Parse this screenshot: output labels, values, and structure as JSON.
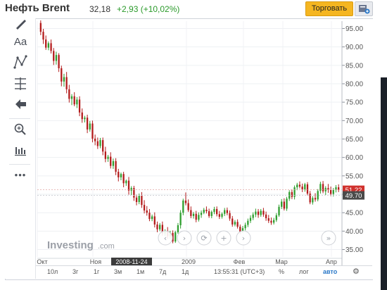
{
  "header": {
    "title": "Нефть Brent",
    "price": "32,18",
    "change": "+2,93 (+10,02%)",
    "trade_button": "Торговать"
  },
  "toolbar": {
    "icons": [
      "pencil-icon",
      "text-icon",
      "pattern-icon",
      "fibonacci-icon",
      "back-arrow-icon",
      "zoom-icon",
      "indicators-icon",
      "more-icon"
    ],
    "text_tool_label": "Aa",
    "more_label": "•••"
  },
  "chart_data": {
    "type": "candlestick",
    "title": "",
    "xlabel": "",
    "ylabel": "",
    "ylim": [
      33,
      97
    ],
    "yticks": [
      35,
      40,
      45,
      50,
      55,
      60,
      65,
      70,
      75,
      80,
      85,
      90,
      95
    ],
    "ytick_labels": [
      "35.00",
      "40.00",
      "45.00",
      "50.00",
      "55.00",
      "60.00",
      "65.00",
      "70.00",
      "75.00",
      "80.00",
      "85.00",
      "90.00",
      "95.00"
    ],
    "x_labels": [
      "Окт",
      "Ноя",
      "Дек",
      "2009",
      "Фев",
      "Мар",
      "Апр"
    ],
    "crosshair_date": "2008-11-24",
    "price_badges": [
      {
        "value": "51.22",
        "color": "#d0312d"
      },
      {
        "value": "49.70",
        "color": "#4a4a4a"
      }
    ],
    "watermark_main": "Investing",
    "watermark_suffix": ".com",
    "up_color": "#2e9e2e",
    "down_color": "#b31b1b",
    "closes": [
      96.5,
      94.8,
      91.5,
      89.0,
      86.5,
      84.5,
      82.0,
      80.5,
      79.5,
      78.5,
      77.0,
      75.5,
      74.5,
      74.0,
      72.8,
      72.0,
      71.5,
      70.5,
      69.5,
      68.5,
      67.5,
      66.5,
      65.5,
      64.5,
      63.5,
      62.5,
      61.5,
      60.5,
      59.8,
      59.0,
      58.3,
      57.6,
      57.0,
      56.2,
      55.5,
      54.8,
      54.0,
      53.2,
      52.5,
      51.8,
      51.0,
      50.3,
      49.7,
      49.0,
      48.3,
      47.7,
      47.0,
      46.3,
      45.6,
      45.0,
      44.4,
      43.8,
      43.2,
      42.6,
      42.0,
      41.5,
      41.0,
      40.5,
      40.2,
      40.0,
      40.2,
      40.5,
      40.8,
      41.2,
      41.6,
      42.0,
      42.4,
      42.8,
      43.2,
      43.6,
      44.0,
      44.3,
      44.6,
      44.8,
      45.0,
      45.2,
      45.3,
      45.4,
      45.5,
      45.5,
      45.4,
      45.3,
      45.1,
      44.9,
      44.7,
      44.5,
      44.3,
      44.1,
      43.9,
      43.7,
      43.5,
      43.3,
      43.1,
      42.9,
      42.7,
      42.5,
      42.5,
      42.7,
      43.0,
      43.4,
      43.8,
      44.2,
      44.6,
      45.0,
      45.5,
      46.0,
      46.6,
      47.2,
      47.8,
      48.4,
      49.0,
      49.6,
      50.2,
      50.7,
      51.2,
      51.6,
      52.0,
      52.3,
      52.5,
      52.4,
      52.2,
      51.9,
      51.6,
      51.3,
      51.1,
      50.9,
      50.7,
      50.6,
      50.5,
      50.5,
      50.6,
      50.8,
      51.0,
      51.2
    ],
    "candles": [
      [
        96.5,
        97.2,
        93.2,
        94.1
      ],
      [
        94.1,
        94.9,
        90.8,
        92.0
      ],
      [
        92.0,
        93.1,
        89.2,
        89.8
      ],
      [
        89.8,
        91.5,
        89.1,
        91.0
      ],
      [
        91.0,
        92.0,
        88.2,
        88.9
      ],
      [
        88.9,
        89.7,
        85.1,
        86.2
      ],
      [
        86.2,
        88.7,
        85.2,
        87.8
      ],
      [
        87.8,
        88.3,
        83.2,
        84.2
      ],
      [
        84.2,
        84.9,
        79.3,
        80.6
      ],
      [
        80.6,
        82.7,
        79.2,
        81.8
      ],
      [
        81.8,
        83.2,
        77.4,
        78.5
      ],
      [
        78.5,
        79.7,
        74.9,
        75.9
      ],
      [
        75.9,
        77.2,
        74.2,
        76.6
      ],
      [
        76.6,
        77.7,
        73.9,
        74.4
      ],
      [
        74.4,
        76.4,
        73.4,
        75.7
      ],
      [
        75.7,
        76.6,
        71.2,
        72.2
      ],
      [
        72.2,
        73.3,
        69.4,
        70.4
      ],
      [
        70.4,
        71.3,
        69.5,
        70.8
      ],
      [
        70.8,
        71.6,
        66.6,
        67.6
      ],
      [
        67.6,
        69.9,
        67.0,
        69.2
      ],
      [
        69.2,
        70.0,
        64.1,
        65.1
      ],
      [
        65.1,
        66.2,
        63.3,
        64.4
      ],
      [
        64.4,
        65.4,
        62.3,
        63.1
      ],
      [
        63.1,
        65.3,
        62.5,
        64.7
      ],
      [
        64.7,
        65.4,
        60.6,
        61.6
      ],
      [
        61.6,
        62.9,
        58.7,
        59.6
      ],
      [
        59.6,
        60.7,
        58.8,
        60.2
      ],
      [
        60.2,
        61.4,
        57.0,
        57.7
      ],
      [
        57.7,
        59.7,
        56.9,
        59.0
      ],
      [
        59.0,
        59.8,
        55.2,
        56.1
      ],
      [
        56.1,
        56.9,
        53.5,
        54.6
      ],
      [
        54.6,
        55.9,
        53.8,
        55.5
      ],
      [
        55.5,
        56.1,
        51.9,
        53.0
      ],
      [
        53.0,
        54.0,
        52.3,
        53.7
      ],
      [
        53.7,
        54.7,
        49.9,
        51.0
      ],
      [
        51.0,
        52.2,
        49.8,
        51.7
      ],
      [
        51.7,
        52.3,
        48.2,
        49.1
      ],
      [
        49.1,
        49.9,
        47.0,
        47.9
      ],
      [
        47.9,
        50.2,
        47.3,
        49.6
      ],
      [
        49.6,
        50.6,
        46.3,
        47.1
      ],
      [
        47.1,
        48.4,
        44.8,
        45.6
      ],
      [
        45.6,
        46.8,
        44.2,
        45.0
      ],
      [
        45.0,
        46.0,
        42.7,
        43.3
      ],
      [
        43.3,
        44.5,
        42.7,
        44.0
      ],
      [
        44.0,
        45.1,
        41.0,
        41.8
      ],
      [
        41.8,
        42.6,
        39.7,
        40.5
      ],
      [
        40.5,
        42.2,
        40.0,
        41.7
      ],
      [
        41.7,
        42.6,
        38.8,
        39.4
      ],
      [
        39.4,
        40.5,
        38.7,
        40.0
      ],
      [
        40.0,
        41.1,
        37.9,
        38.6
      ],
      [
        38.6,
        40.1,
        37.9,
        39.5
      ],
      [
        39.5,
        40.2,
        36.7,
        37.2
      ],
      [
        37.2,
        40.1,
        36.8,
        39.7
      ],
      [
        39.7,
        42.2,
        39.3,
        41.6
      ],
      [
        41.6,
        45.7,
        40.7,
        45.0
      ],
      [
        45.0,
        48.8,
        44.3,
        48.3
      ],
      [
        48.3,
        50.5,
        47.0,
        47.6
      ],
      [
        47.6,
        48.6,
        45.2,
        45.7
      ],
      [
        45.7,
        46.7,
        43.5,
        44.1
      ],
      [
        44.1,
        45.2,
        43.4,
        44.7
      ],
      [
        44.7,
        45.5,
        42.4,
        43.1
      ],
      [
        43.1,
        45.1,
        42.6,
        44.4
      ],
      [
        44.4,
        45.6,
        43.6,
        45.0
      ],
      [
        45.0,
        46.3,
        44.6,
        45.8
      ],
      [
        45.8,
        46.7,
        44.8,
        45.4
      ],
      [
        45.4,
        46.1,
        43.6,
        44.1
      ],
      [
        44.1,
        45.6,
        43.5,
        45.2
      ],
      [
        45.2,
        46.6,
        44.6,
        46.0
      ],
      [
        46.0,
        46.7,
        44.0,
        44.6
      ],
      [
        44.6,
        45.5,
        43.3,
        43.9
      ],
      [
        43.9,
        45.1,
        43.4,
        44.7
      ],
      [
        44.7,
        46.3,
        44.1,
        45.7
      ],
      [
        45.7,
        46.4,
        44.3,
        44.9
      ],
      [
        44.9,
        45.6,
        42.8,
        43.4
      ],
      [
        43.4,
        44.1,
        41.2,
        41.8
      ],
      [
        41.8,
        43.0,
        41.3,
        42.5
      ],
      [
        42.5,
        43.2,
        40.7,
        41.2
      ],
      [
        41.2,
        41.8,
        39.2,
        39.9
      ],
      [
        39.9,
        41.4,
        39.5,
        40.8
      ],
      [
        40.8,
        42.3,
        40.2,
        41.7
      ],
      [
        41.7,
        43.4,
        41.1,
        42.8
      ],
      [
        42.8,
        44.3,
        42.2,
        43.6
      ],
      [
        43.6,
        45.1,
        43.0,
        44.5
      ],
      [
        44.5,
        46.1,
        43.8,
        45.3
      ],
      [
        45.3,
        46.0,
        43.6,
        44.4
      ],
      [
        44.4,
        46.0,
        43.9,
        45.5
      ],
      [
        45.5,
        46.3,
        43.9,
        44.5
      ],
      [
        44.5,
        45.3,
        42.8,
        43.5
      ],
      [
        43.5,
        44.4,
        42.2,
        42.8
      ],
      [
        42.8,
        43.7,
        41.7,
        42.3
      ],
      [
        42.3,
        43.6,
        41.8,
        43.0
      ],
      [
        43.0,
        44.9,
        42.5,
        44.3
      ],
      [
        44.3,
        47.2,
        43.9,
        46.6
      ],
      [
        46.6,
        48.7,
        46.0,
        48.0
      ],
      [
        48.0,
        48.9,
        45.6,
        46.1
      ],
      [
        46.1,
        49.3,
        45.5,
        48.8
      ],
      [
        48.8,
        51.1,
        48.2,
        50.6
      ],
      [
        50.6,
        51.3,
        48.7,
        49.3
      ],
      [
        49.3,
        52.4,
        48.6,
        51.9
      ],
      [
        51.9,
        53.1,
        51.1,
        52.6
      ],
      [
        52.6,
        53.5,
        51.6,
        52.1
      ],
      [
        52.1,
        52.9,
        50.6,
        51.3
      ],
      [
        51.3,
        53.1,
        50.7,
        52.7
      ],
      [
        52.7,
        53.3,
        49.7,
        50.2
      ],
      [
        50.2,
        50.9,
        47.3,
        47.8
      ],
      [
        47.8,
        49.5,
        47.2,
        49.0
      ],
      [
        49.0,
        50.3,
        48.0,
        48.6
      ],
      [
        48.6,
        51.4,
        48.1,
        50.9
      ],
      [
        50.9,
        53.4,
        50.2,
        52.8
      ],
      [
        52.8,
        53.6,
        50.3,
        50.8
      ],
      [
        50.8,
        52.2,
        49.8,
        51.7
      ],
      [
        51.7,
        52.8,
        50.4,
        51.2
      ],
      [
        51.2,
        52.1,
        49.5,
        50.1
      ],
      [
        50.1,
        51.7,
        49.4,
        51.2
      ],
      [
        51.2,
        52.5,
        50.5,
        51.9
      ],
      [
        51.9,
        52.7,
        50.6,
        51.2
      ]
    ]
  },
  "nav_buttons": [
    "‹",
    "›",
    "⟳",
    "+",
    "›"
  ],
  "bottom_bar": {
    "timeframes": [
      "10л",
      "3г",
      "1г",
      "3м",
      "1м",
      "7д",
      "1д"
    ],
    "time_readout": "13:55:31 (UTC+3)",
    "percent": "%",
    "log": "лог",
    "auto": "авто"
  }
}
